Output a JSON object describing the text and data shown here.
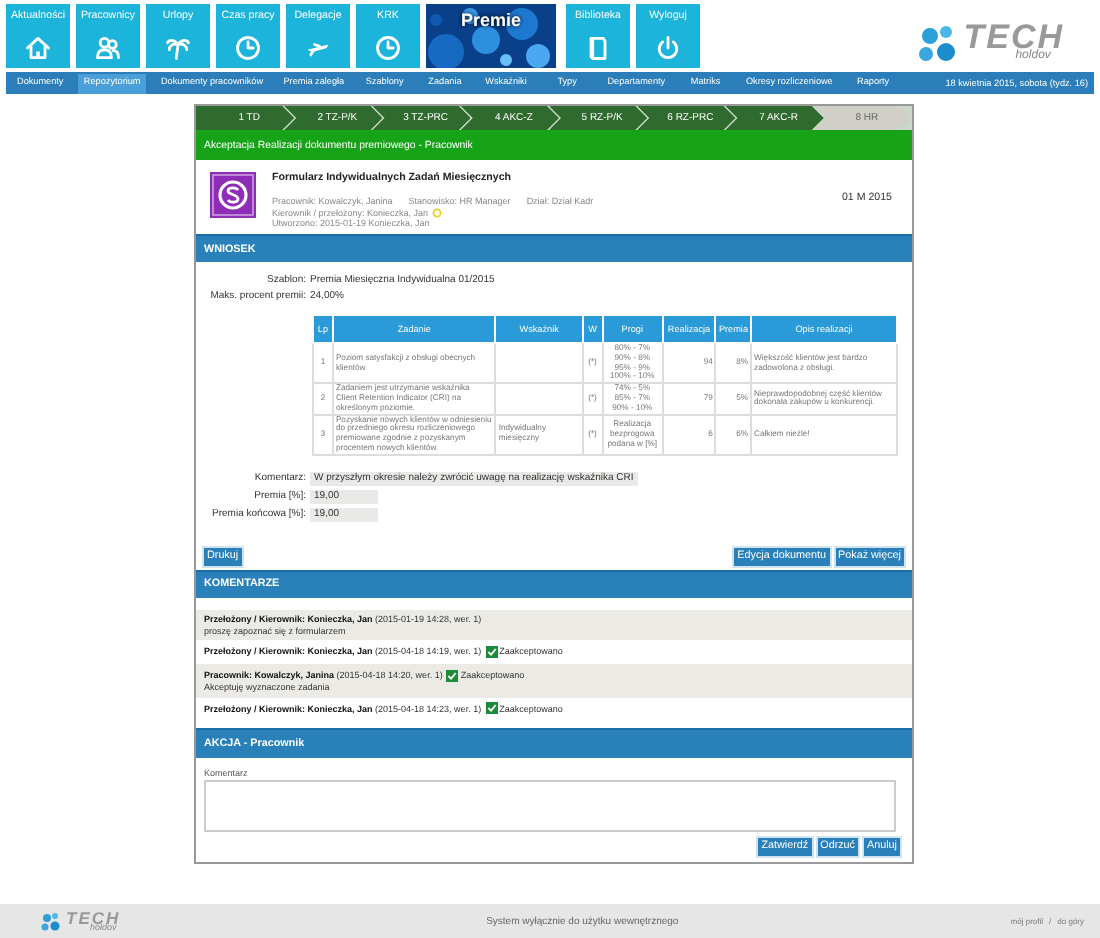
{
  "nav": {
    "tiles": [
      {
        "label": "Aktualności",
        "selected": false
      },
      {
        "label": "Pracownicy",
        "selected": false
      },
      {
        "label": "Urlopy",
        "selected": false
      },
      {
        "label": "Czas pracy",
        "selected": false
      },
      {
        "label": "Delegacje",
        "selected": false
      },
      {
        "label": "KRK",
        "selected": false
      },
      {
        "label": "Premie",
        "selected": true
      },
      {
        "label": "Biblioteka",
        "selected": false
      },
      {
        "label": "Wyloguj",
        "selected": false
      }
    ],
    "logo": {
      "text": "TECH",
      "subtext": "holdov"
    }
  },
  "subnav": {
    "items": [
      {
        "label": "Dokumenty",
        "selected": false
      },
      {
        "label": "Repozytorium",
        "selected": true
      },
      {
        "label": "Dokumenty pracowników",
        "selected": false
      },
      {
        "label": "Premia zaległa",
        "selected": false
      },
      {
        "label": "Szablony",
        "selected": false
      },
      {
        "label": "Zadania",
        "selected": false
      },
      {
        "label": "Wskaźniki",
        "selected": false
      },
      {
        "label": "Typy",
        "selected": false
      },
      {
        "label": "Departamenty",
        "selected": false
      },
      {
        "label": "Matriks",
        "selected": false
      },
      {
        "label": "Okresy rozliczeniowe",
        "selected": false
      },
      {
        "label": "Raporty",
        "selected": false
      }
    ],
    "date": "18 kwietnia 2015, sobota (tydz. 16)"
  },
  "steps": [
    {
      "label": "1 TD",
      "done": true
    },
    {
      "label": "2 TZ-P/K",
      "done": true
    },
    {
      "label": "3 TZ-PRC",
      "done": true
    },
    {
      "label": "4 AKC-Z",
      "done": true
    },
    {
      "label": "5 RZ-P/K",
      "done": true
    },
    {
      "label": "6 RZ-PRC",
      "done": true
    },
    {
      "label": "7 AKC-R",
      "done": true
    },
    {
      "label": "8 HR",
      "done": false
    }
  ],
  "stage_title": "Akceptacja Realizacji dokumentu premiowego - Pracownik",
  "document": {
    "title": "Formularz Indywidualnych Zadań Miesięcznych",
    "period": "01 M 2015",
    "employee": "Pracownik: Kowalczyk, Janina",
    "position": "Stanowisko: HR Manager",
    "department": "Dział: Dział Kadr",
    "manager": "Kierownik / przełożony: Konieczka, Jan",
    "created": "Utworzono: 2015-01-19 Konieczka, Jan"
  },
  "request": {
    "heading": "WNIOSEK",
    "fields": [
      {
        "label": "Szablon:",
        "value": "Premia Miesięczna Indywidualna 01/2015"
      },
      {
        "label": "Maks. procent premii:",
        "value": "24,00%"
      }
    ],
    "table": {
      "columns": [
        "Lp",
        "Zadanie",
        "Wskaźnik",
        "W",
        "Progi",
        "Realizacja",
        "Premia",
        "Opis realizacji"
      ],
      "rows": [
        {
          "lp": "1",
          "task": "Poziom satysfakcji z obsługi obecnych klientów",
          "indicator": "",
          "weight": "(*)",
          "thresholds": [
            "80% - 7%",
            "90% - 8%",
            "95% - 9%",
            "100% - 10%"
          ],
          "realization": "94",
          "bonus": "8%",
          "description": "Większość klientów jest bardzo zadowolona z obsługi."
        },
        {
          "lp": "2",
          "task": "Zadaniem jest utrzymanie wskaźnika Client Retention Indicator (CRI) na określonym poziomie.",
          "indicator": "",
          "weight": "(*)",
          "thresholds": [
            "74% - 5%",
            "85% - 7%",
            "90% - 10%"
          ],
          "realization": "79",
          "bonus": "5%",
          "description": "Nieprawdopodobnej część klientów dokonała zakupów u konkurencji."
        },
        {
          "lp": "3",
          "task": "Pozyskanie nowych klientów w odniesieniu do przedniego okresu rozliczeniowego premiowane zgodnie z pozyskanym procentem nowych klientów.",
          "indicator": "Indywidualny miesięczny",
          "weight": "(*)",
          "thresholds": [
            "Realizacja bezprogowa podana w [%]"
          ],
          "realization": "6",
          "bonus": "6%",
          "description": "Całkiem nieźle!"
        }
      ]
    },
    "comment": {
      "label": "Komentarz:",
      "value": "W przyszłym okresie należy zwrócić uwagę na realizację wskaźnika CRI"
    },
    "bonus": {
      "label": "Premia [%]:",
      "value": "19,00"
    },
    "final_bonus": {
      "label": "Premia końcowa [%]:",
      "value": "19,00"
    },
    "buttons_left": [
      "Drukuj"
    ],
    "buttons_right": [
      "Edycja dokumentu",
      "Pokaż więcej"
    ]
  },
  "comments": {
    "heading": "KOMENTARZE",
    "items": [
      {
        "header": "**Przełożony / Kierownik: Konieczka, Jan** (2015-01-19 14:28, wer. 1)",
        "text": "proszę zapoznać się z formularzem"
      },
      {
        "header": "**Przełożony / Kierownik: Konieczka, Jan** (2015-04-18 14:19, wer. 1)",
        "status": "Zaakceptowano"
      },
      {
        "header": "**Pracownik: Kowalczyk, Janina** (2015-04-18 14:20, wer. 1)",
        "status": "Zaakceptowano",
        "text": "Akceptuję wyznaczone zadania"
      },
      {
        "header": "**Przełożony / Kierownik: Konieczka, Jan** (2015-04-18 14:23, wer. 1)",
        "status": "Zaakceptowano"
      }
    ]
  },
  "action": {
    "heading": "AKCJA - Pracownik",
    "comment_label": "Komentarz",
    "buttons": [
      "Zatwierdź",
      "Odrzuć",
      "Anuluj"
    ]
  },
  "footer": {
    "logo": {
      "text": "TECH",
      "subtext": "holdov"
    },
    "note": "System wyłącznie do użytku wewnętrznego",
    "links": [
      "mój profil",
      "do góry"
    ],
    "separator": "/"
  }
}
